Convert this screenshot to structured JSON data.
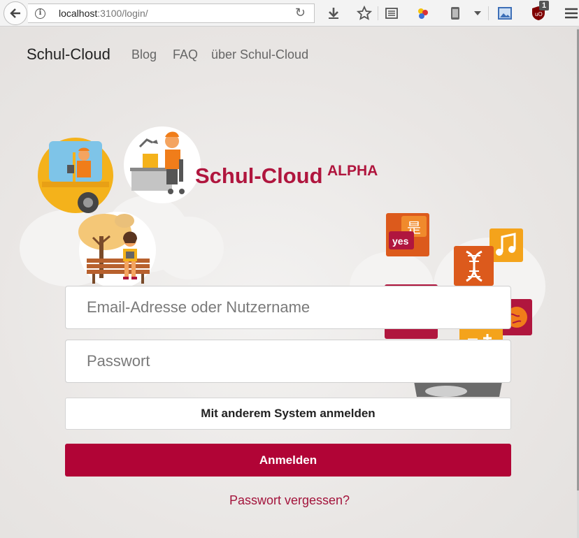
{
  "browser": {
    "url_host": "localhost",
    "url_rest": ":3100/login/",
    "notification_count": "1"
  },
  "nav": {
    "brand": "Schul-Cloud",
    "links": [
      "Blog",
      "FAQ",
      "über Schul-Cloud"
    ]
  },
  "logo": {
    "title": "Schul-Cloud",
    "tag": "ALPHA"
  },
  "illustration": {
    "chinese_char": "是",
    "yes_label": "yes"
  },
  "form": {
    "email_placeholder": "Email-Adresse oder Nutzername",
    "password_placeholder": "Passwort",
    "alt_login_label": "Mit anderem System anmelden",
    "login_label": "Anmelden",
    "forgot_label": "Passwort vergessen?"
  },
  "colors": {
    "brand": "#b10436",
    "link": "#a3143c"
  }
}
